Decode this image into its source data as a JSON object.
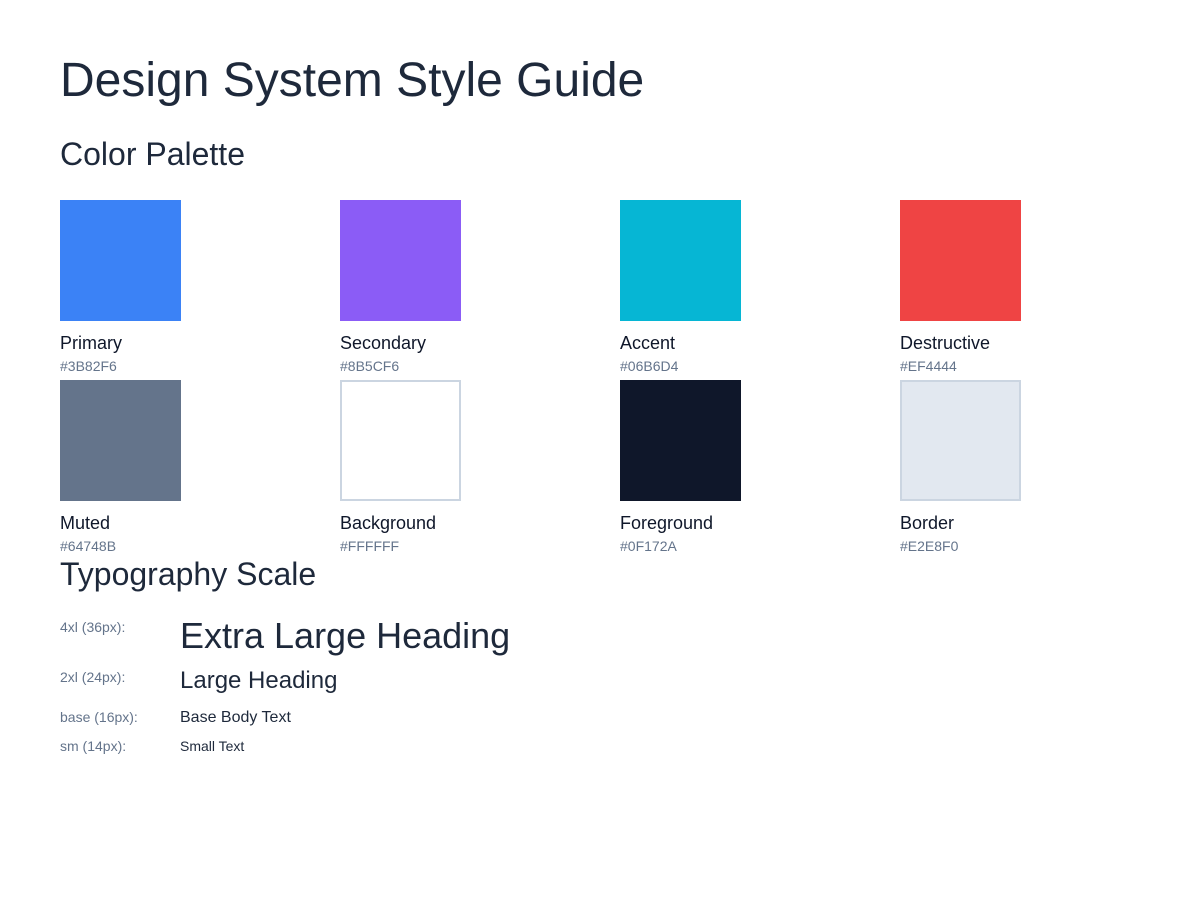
{
  "page": {
    "title": "Design System Style Guide"
  },
  "palette": {
    "title": "Color Palette",
    "colors": [
      {
        "name": "Primary",
        "hex": "#3B82F6"
      },
      {
        "name": "Secondary",
        "hex": "#8B5CF6"
      },
      {
        "name": "Accent",
        "hex": "#06B6D4"
      },
      {
        "name": "Destructive",
        "hex": "#EF4444"
      },
      {
        "name": "Muted",
        "hex": "#64748B"
      },
      {
        "name": "Background",
        "hex": "#FFFFFF"
      },
      {
        "name": "Foreground",
        "hex": "#0F172A"
      },
      {
        "name": "Border",
        "hex": "#E2E8F0"
      }
    ]
  },
  "typography": {
    "title": "Typography Scale",
    "rows": [
      {
        "label": "4xl (36px):",
        "sample": "Extra Large Heading"
      },
      {
        "label": "2xl (24px):",
        "sample": "Large Heading"
      },
      {
        "label": "base (16px):",
        "sample": "Base Body Text"
      },
      {
        "label": "sm (14px):",
        "sample": "Small Text"
      }
    ]
  }
}
